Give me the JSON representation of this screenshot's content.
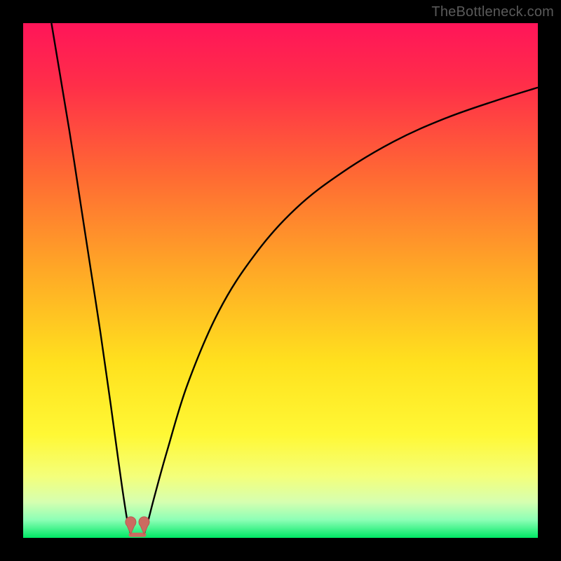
{
  "watermark": "TheBottleneck.com",
  "colors": {
    "frame": "#000000",
    "curve": "#000000",
    "marker_fill": "#cc6a60",
    "marker_stroke": "#b85a50",
    "gradient_stops": [
      {
        "offset": 0.0,
        "color": "#ff1559"
      },
      {
        "offset": 0.12,
        "color": "#ff2e49"
      },
      {
        "offset": 0.3,
        "color": "#ff6b33"
      },
      {
        "offset": 0.48,
        "color": "#ffa826"
      },
      {
        "offset": 0.66,
        "color": "#ffe11e"
      },
      {
        "offset": 0.8,
        "color": "#fff835"
      },
      {
        "offset": 0.88,
        "color": "#f4ff7a"
      },
      {
        "offset": 0.93,
        "color": "#d6ffb0"
      },
      {
        "offset": 0.965,
        "color": "#8dffb6"
      },
      {
        "offset": 1.0,
        "color": "#00e865"
      }
    ]
  },
  "chart_data": {
    "type": "line",
    "title": "",
    "xlabel": "",
    "ylabel": "",
    "xlim": [
      0,
      100
    ],
    "ylim": [
      0,
      100
    ],
    "series": [
      {
        "name": "left-branch",
        "x": [
          5.5,
          7,
          9,
          11,
          13,
          15,
          17,
          18.5,
          19.5,
          20.3,
          20.9
        ],
        "y": [
          100,
          91,
          79,
          66,
          53,
          40,
          26,
          15,
          8,
          3,
          0.8
        ]
      },
      {
        "name": "right-branch",
        "x": [
          23.5,
          24.2,
          25.5,
          28,
          32,
          38,
          45,
          53,
          62,
          72,
          82,
          92,
          100
        ],
        "y": [
          0.8,
          3,
          8,
          17,
          30,
          44,
          55,
          64,
          71,
          77,
          81.5,
          85,
          87.5
        ]
      }
    ],
    "markers": [
      {
        "name": "min-left",
        "x": 20.9,
        "y": 1.0
      },
      {
        "name": "min-right",
        "x": 23.5,
        "y": 1.0
      }
    ],
    "minimum_band": {
      "x_start": 20.9,
      "x_end": 23.5,
      "y": 0.6
    }
  }
}
